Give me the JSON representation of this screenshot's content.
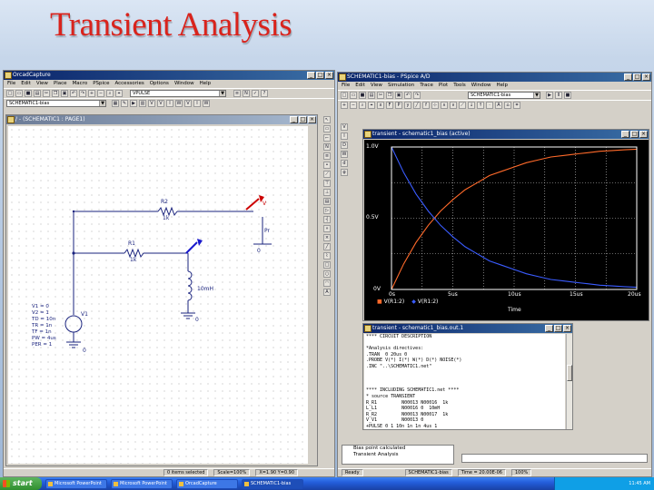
{
  "slide": {
    "title": "Transient Analysis"
  },
  "capture_window": {
    "title": "OrcadCapture",
    "menu": [
      "File",
      "Edit",
      "View",
      "Place",
      "Macro",
      "PSpice",
      "Accessories",
      "Options",
      "Window",
      "Help"
    ],
    "part_combo": "VPULSE",
    "profile_combo": "SCHEMATIC1-bias",
    "status": {
      "items": "0 items selected",
      "scale": "Scale=100%",
      "pos": "X=1.90  Y=0.90"
    }
  },
  "schematic_window": {
    "title": "/ - (SCHEMATIC1 : PAGE1)",
    "parts": {
      "r2_label": "R2",
      "r2_value": "1k",
      "r1_label": "R1",
      "r1_value": "1k",
      "v1_label": "V1",
      "l_value": "10mH",
      "source_props": [
        "V1 = 0",
        "V2 = 1",
        "TD = 10n",
        "TR = 1n",
        "TF = 1n",
        "PW = 4us",
        "PER = 1"
      ],
      "probe_v": "V",
      "gnd_0": "0",
      "gnd_b": "0",
      "gnd_c": "0",
      "pr_label": "Pr"
    }
  },
  "pspice_window": {
    "title": "SCHEMATIC1-bias - PSpice A/D",
    "menu": [
      "File",
      "Edit",
      "View",
      "Simulation",
      "Trace",
      "Plot",
      "Tools",
      "Window",
      "Help"
    ],
    "profile_combo": "SCHEMATIC1-bias",
    "plot_window": {
      "title": "transient - schematic1_bias (active)",
      "y_ticks": [
        "1.0V",
        "0.5V",
        "0V"
      ],
      "x_ticks": [
        "0s",
        "5us",
        "10us",
        "15us",
        "20us"
      ],
      "x_label": "Time",
      "legend": [
        "V(R1:2)",
        "V(R1:2)"
      ]
    },
    "output_window": {
      "title": "transient - schematic1_bias.out.1",
      "lines": [
        "**** CIRCUIT DESCRIPTION",
        "",
        "*Analysis directives:",
        ".TRAN  0 20us 0",
        ".PROBE V(*) I(*) W(*) D(*) NOISE(*)",
        ".INC \"..\\SCHEMATIC1.net\"",
        "",
        "",
        "",
        "**** INCLUDING SCHEMATIC1.net ****",
        "* source TRANSIENT",
        "R_R1         N00013 N00016  1k",
        "L_L1         N00016 0  10mH",
        "R_R2         N00013 N00017  1k",
        "V_V1         N00013 0",
        "+PULSE 0 1 10n 1n 1n 4us 1",
        ""
      ]
    },
    "sim_panel": {
      "line1": "Bias point calculated",
      "line2": "Transient Analysis"
    },
    "status": {
      "ready": "Ready",
      "profile": "SCHEMATIC1-bias",
      "time": "Time = 20.00E-06",
      "pct": "100%"
    }
  },
  "taskbar": {
    "start": "start",
    "buttons": [
      "Microsoft PowerPoint",
      "Microsoft PowerPoint",
      "OrcadCapture",
      "SCHEMATIC1-bias"
    ],
    "tray_time": "11:45 AM"
  },
  "chart_data": {
    "type": "line",
    "title": "",
    "xlabel": "Time",
    "ylabel": "",
    "x_unit": "us",
    "xlim": [
      0,
      20
    ],
    "ylim": [
      0,
      1.0
    ],
    "series": [
      {
        "name": "V(R1:2)",
        "color": "#ff6a2a",
        "x": [
          0,
          1,
          2,
          3,
          4,
          5,
          6,
          7,
          8,
          9,
          10,
          11,
          12,
          13,
          14,
          15,
          16,
          17,
          18,
          19,
          20
        ],
        "y": [
          0,
          0.18,
          0.33,
          0.45,
          0.55,
          0.63,
          0.7,
          0.75,
          0.8,
          0.83,
          0.86,
          0.89,
          0.91,
          0.93,
          0.94,
          0.95,
          0.96,
          0.97,
          0.975,
          0.98,
          0.985
        ]
      },
      {
        "name": "V(R1:2)",
        "color": "#3a5cff",
        "x": [
          0,
          1,
          2,
          3,
          4,
          5,
          6,
          7,
          8,
          9,
          10,
          11,
          12,
          13,
          14,
          15,
          16,
          17,
          18,
          19,
          20
        ],
        "y": [
          1.0,
          0.82,
          0.67,
          0.55,
          0.45,
          0.37,
          0.3,
          0.25,
          0.2,
          0.17,
          0.14,
          0.11,
          0.09,
          0.07,
          0.06,
          0.05,
          0.04,
          0.03,
          0.025,
          0.02,
          0.015
        ]
      }
    ]
  }
}
